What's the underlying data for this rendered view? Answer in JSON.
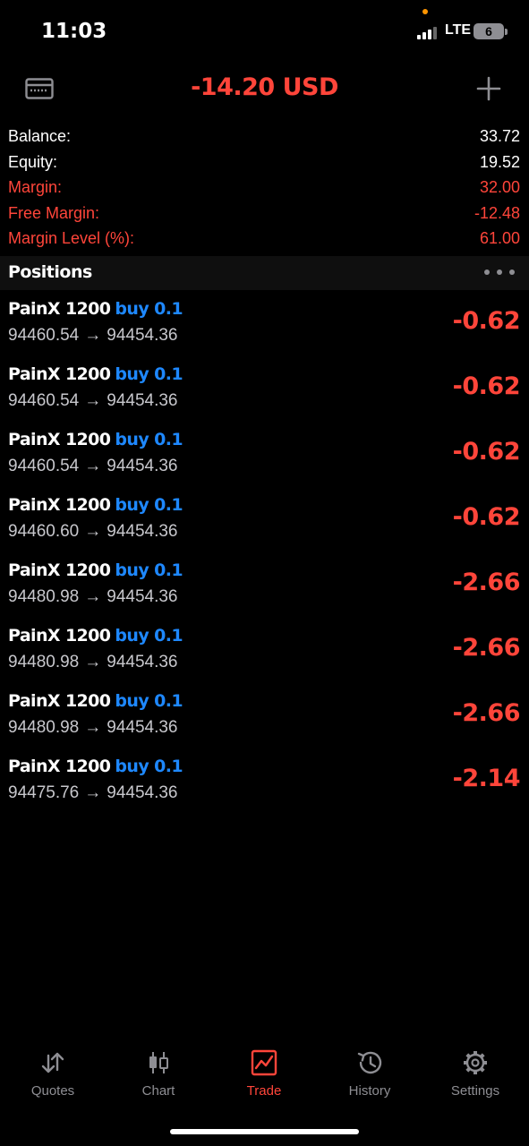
{
  "status_bar": {
    "time": "11:03",
    "network": "LTE",
    "battery": "6"
  },
  "header": {
    "total_pl": "-14.20 USD",
    "left_icon": "card-icon",
    "right_icon": "plus-icon"
  },
  "summary": [
    {
      "label": "Balance:",
      "value": "33.72",
      "color": "#ffffff"
    },
    {
      "label": "Equity:",
      "value": "19.52",
      "color": "#ffffff"
    },
    {
      "label": "Margin:",
      "value": "32.00",
      "color": "#ff453a"
    },
    {
      "label": "Free Margin:",
      "value": "-12.48",
      "color": "#ff453a"
    },
    {
      "label": "Margin Level (%):",
      "value": "61.00",
      "color": "#ff453a"
    }
  ],
  "positions_section": {
    "title": "Positions",
    "more_icon": "more-icon"
  },
  "positions": [
    {
      "symbol": "PainX 1200",
      "type": "buy 0.1",
      "open_price": "94460.54",
      "arrow": "→",
      "current_price": "94454.36",
      "profit": "-0.62"
    },
    {
      "symbol": "PainX 1200",
      "type": "buy 0.1",
      "open_price": "94460.54",
      "arrow": "→",
      "current_price": "94454.36",
      "profit": "-0.62"
    },
    {
      "symbol": "PainX 1200",
      "type": "buy 0.1",
      "open_price": "94460.54",
      "arrow": "→",
      "current_price": "94454.36",
      "profit": "-0.62"
    },
    {
      "symbol": "PainX 1200",
      "type": "buy 0.1",
      "open_price": "94460.60",
      "arrow": "→",
      "current_price": "94454.36",
      "profit": "-0.62"
    },
    {
      "symbol": "PainX 1200",
      "type": "buy 0.1",
      "open_price": "94480.98",
      "arrow": "→",
      "current_price": "94454.36",
      "profit": "-2.66"
    },
    {
      "symbol": "PainX 1200",
      "type": "buy 0.1",
      "open_price": "94480.98",
      "arrow": "→",
      "current_price": "94454.36",
      "profit": "-2.66"
    },
    {
      "symbol": "PainX 1200",
      "type": "buy 0.1",
      "open_price": "94480.98",
      "arrow": "→",
      "current_price": "94454.36",
      "profit": "-2.66"
    },
    {
      "symbol": "PainX 1200",
      "type": "buy 0.1",
      "open_price": "94475.76",
      "arrow": "→",
      "current_price": "94454.36",
      "profit": "-2.14"
    }
  ],
  "tabs": [
    {
      "label": "Quotes",
      "icon": "quotes-icon",
      "active": false
    },
    {
      "label": "Chart",
      "icon": "chart-icon",
      "active": false
    },
    {
      "label": "Trade",
      "icon": "trade-icon",
      "active": true
    },
    {
      "label": "History",
      "icon": "history-icon",
      "active": false
    },
    {
      "label": "Settings",
      "icon": "settings-icon",
      "active": false
    }
  ],
  "colors": {
    "accent": "#ff453a",
    "buy": "#1e88ff",
    "background": "#000000",
    "muted": "#8e8e93"
  }
}
